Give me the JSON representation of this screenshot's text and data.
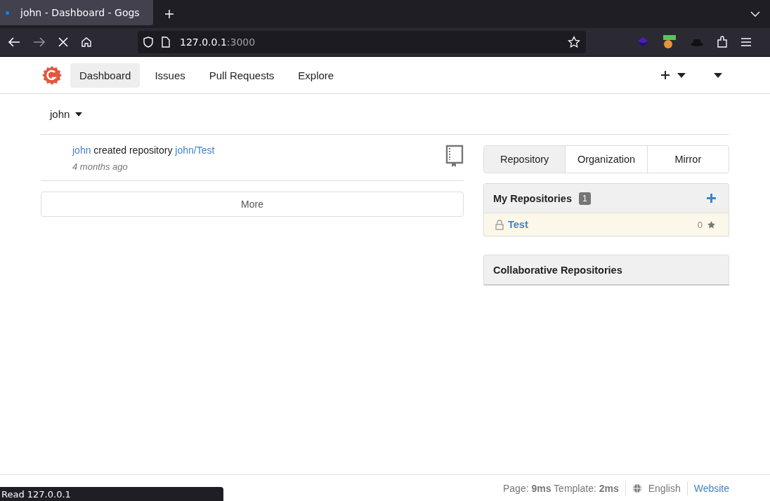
{
  "browser": {
    "tab_title": "john - Dashboard - Gogs",
    "url_host": "127.0.0.1",
    "url_port": ":3000",
    "status_text": "Read 127.0.0.1"
  },
  "nav": {
    "items": [
      {
        "label": "Dashboard",
        "selected": true
      },
      {
        "label": "Issues",
        "selected": false
      },
      {
        "label": "Pull Requests",
        "selected": false
      },
      {
        "label": "Explore",
        "selected": false
      }
    ]
  },
  "context_user": "john",
  "feed": [
    {
      "actor": "john",
      "action": "created repository",
      "target": "john/Test",
      "time": "4 months ago"
    }
  ],
  "more_button": "More",
  "repo_tabs": [
    {
      "label": "Repository",
      "selected": true
    },
    {
      "label": "Organization",
      "selected": false
    },
    {
      "label": "Mirror",
      "selected": false
    }
  ],
  "my_repositories": {
    "title": "My Repositories",
    "count": "1",
    "repos": [
      {
        "name": "Test",
        "private": true,
        "stars": "0"
      }
    ]
  },
  "collaborative_repositories": {
    "title": "Collaborative Repositories"
  },
  "footer": {
    "timing": "Page: **9ms** Template: **2ms**",
    "language": "English",
    "link": "Website"
  }
}
